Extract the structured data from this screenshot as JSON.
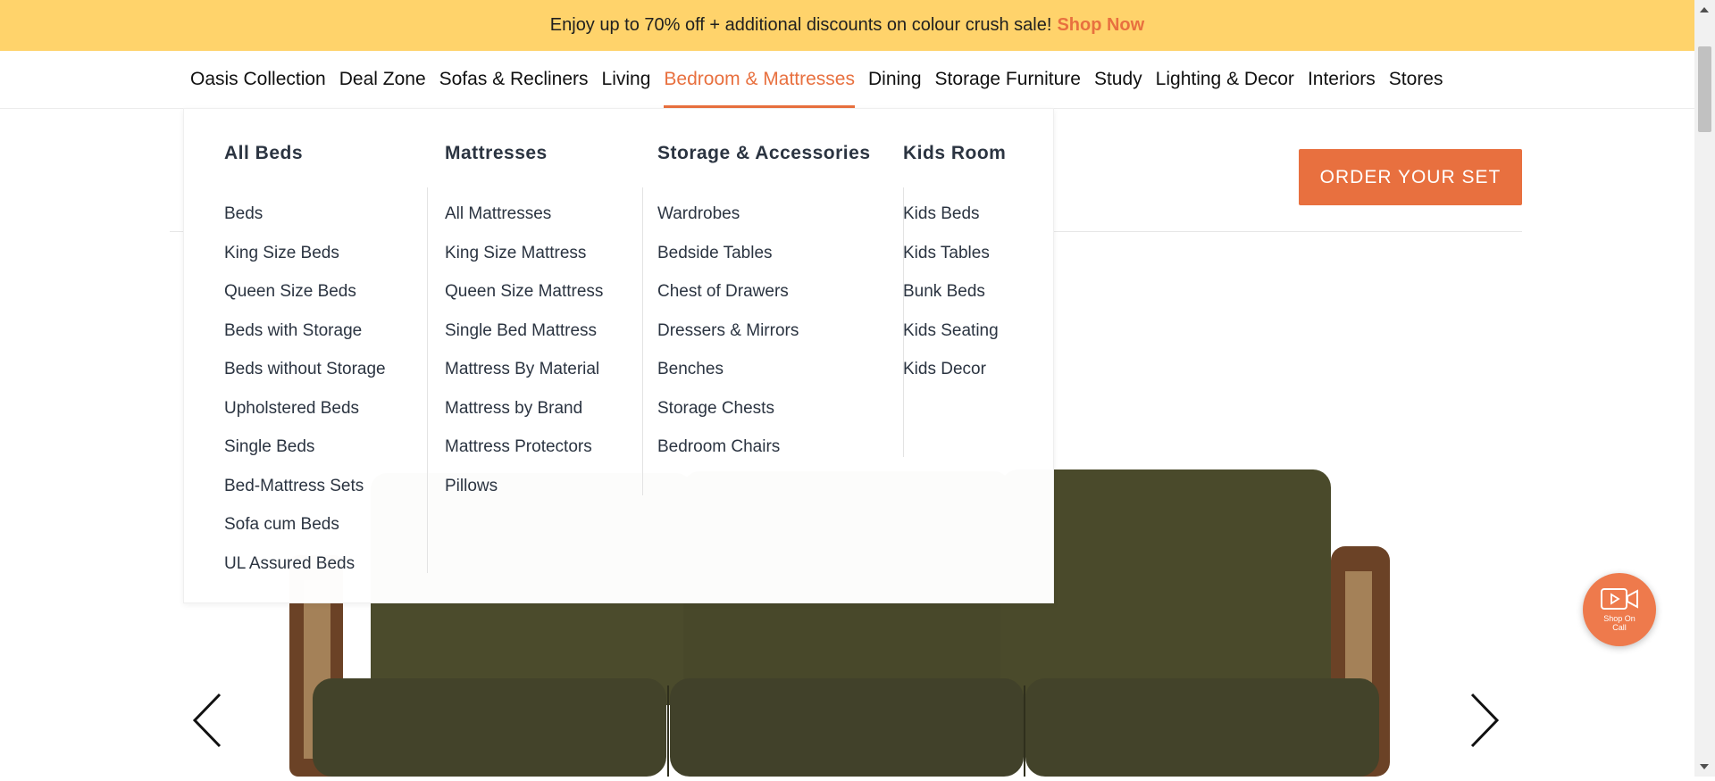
{
  "promo": {
    "text": "Enjoy up to 70% off + additional discounts on colour crush sale!",
    "link": "Shop Now"
  },
  "nav": {
    "items": [
      {
        "label": "Oasis Collection"
      },
      {
        "label": "Deal Zone"
      },
      {
        "label": "Sofas & Recliners"
      },
      {
        "label": "Living"
      },
      {
        "label": "Bedroom & Mattresses",
        "active": true
      },
      {
        "label": "Dining"
      },
      {
        "label": "Storage Furniture"
      },
      {
        "label": "Study"
      },
      {
        "label": "Lighting & Decor"
      },
      {
        "label": "Interiors"
      },
      {
        "label": "Stores"
      }
    ]
  },
  "header": {
    "order_button": "ORDER YOUR SET"
  },
  "mega_menu": {
    "columns": [
      {
        "heading": "All Beds",
        "items": [
          "Beds",
          "King Size Beds",
          "Queen Size Beds",
          "Beds with Storage",
          "Beds without Storage",
          "Upholstered Beds",
          "Single Beds",
          "Bed-Mattress Sets",
          "Sofa cum Beds",
          "UL Assured Beds"
        ]
      },
      {
        "heading": "Mattresses",
        "items": [
          "All Mattresses",
          "King Size Mattress",
          "Queen Size Mattress",
          "Single Bed Mattress",
          "Mattress By Material",
          "Mattress by Brand",
          "Mattress Protectors",
          "Pillows"
        ]
      },
      {
        "heading": "Storage & Accessories",
        "items": [
          "Wardrobes",
          "Bedside Tables",
          "Chest of Drawers",
          "Dressers & Mirrors",
          "Benches",
          "Storage Chests",
          "Bedroom Chairs"
        ]
      },
      {
        "heading": "Kids Room",
        "items": [
          "Kids Beds",
          "Kids Tables",
          "Bunk Beds",
          "Kids Seating",
          "Kids Decor"
        ]
      }
    ]
  },
  "shop_on_call": {
    "label": "Shop On Call",
    "icon": "video-call-icon"
  },
  "carousel": {
    "prev_icon": "chevron-left-icon",
    "next_icon": "chevron-right-icon"
  },
  "colors": {
    "accent": "#e8703f",
    "banner": "#ffd36b",
    "sofa_fabric": "#4a4a2a",
    "sofa_wood": "#6b4226"
  }
}
